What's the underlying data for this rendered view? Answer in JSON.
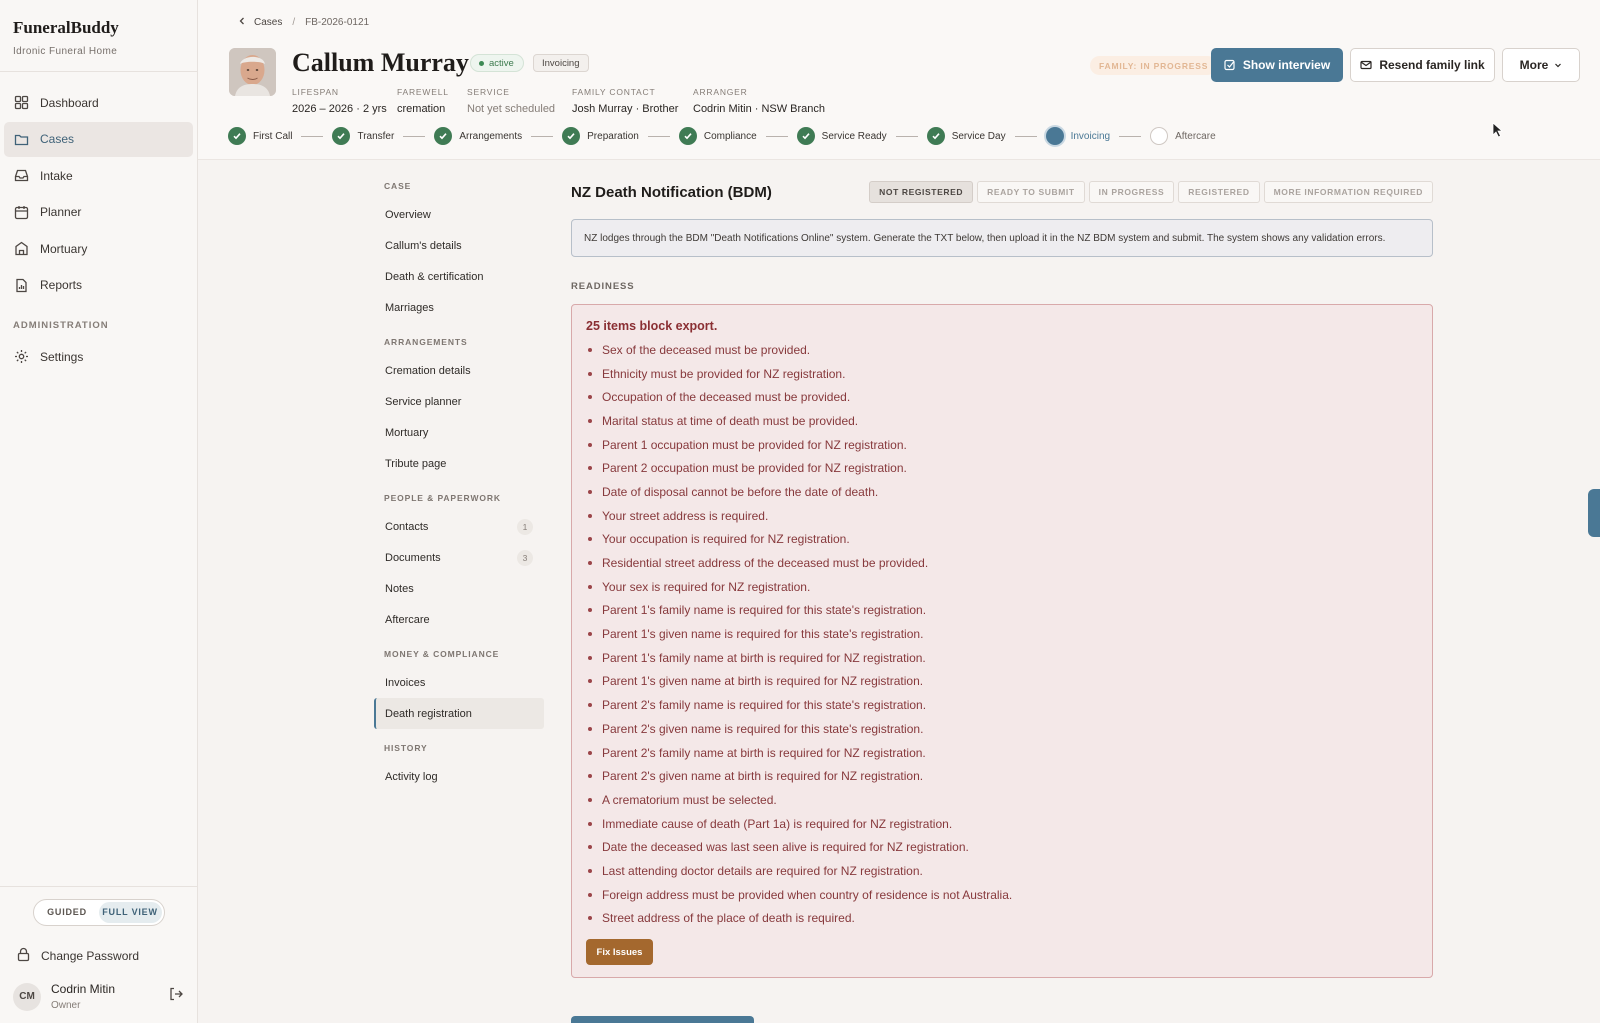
{
  "brand": {
    "name": "FuneralBuddy",
    "org": "Idronic Funeral Home"
  },
  "nav": {
    "items": [
      {
        "label": "Dashboard",
        "icon": "grid-icon"
      },
      {
        "label": "Cases",
        "icon": "folder-icon",
        "active": true
      },
      {
        "label": "Intake",
        "icon": "inbox-icon"
      },
      {
        "label": "Planner",
        "icon": "calendar-icon"
      },
      {
        "label": "Mortuary",
        "icon": "building-icon"
      },
      {
        "label": "Reports",
        "icon": "report-icon"
      }
    ],
    "admin_section": "ADMINISTRATION",
    "settings_label": "Settings"
  },
  "view_toggle": {
    "guided": "GUIDED",
    "full": "FULL VIEW",
    "selected": "FULL VIEW"
  },
  "account": {
    "change_password": "Change Password",
    "initials": "CM",
    "name": "Codrin Mitin",
    "role": "Owner"
  },
  "breadcrumb": {
    "parent": "Cases",
    "current": "FB-2026-0121"
  },
  "case": {
    "name": "Callum Murray",
    "status": "active",
    "stage": "Invoicing",
    "family_status": "FAMILY: IN PROGRESS",
    "meta": [
      {
        "key": "LIFESPAN",
        "value": "2026 – 2026 · 2 yrs"
      },
      {
        "key": "FAREWELL",
        "value": "cremation"
      },
      {
        "key": "SERVICE",
        "value": "Not yet scheduled",
        "muted": true
      },
      {
        "key": "FAMILY CONTACT",
        "value": "Josh Murray · Brother"
      },
      {
        "key": "ARRANGER",
        "value": "Codrin Mitin · NSW Branch"
      }
    ]
  },
  "actions": {
    "show_interview": "Show interview",
    "resend_link": "Resend family link",
    "more": "More"
  },
  "stepper": [
    {
      "label": "First Call",
      "state": "done"
    },
    {
      "label": "Transfer",
      "state": "done"
    },
    {
      "label": "Arrangements",
      "state": "done"
    },
    {
      "label": "Preparation",
      "state": "done"
    },
    {
      "label": "Compliance",
      "state": "done"
    },
    {
      "label": "Service Ready",
      "state": "done"
    },
    {
      "label": "Service Day",
      "state": "done"
    },
    {
      "label": "Invoicing",
      "state": "current"
    },
    {
      "label": "Aftercare",
      "state": "todo"
    }
  ],
  "case_nav": [
    {
      "section": "CASE",
      "items": [
        {
          "label": "Overview"
        },
        {
          "label": "Callum's details"
        },
        {
          "label": "Death & certification"
        },
        {
          "label": "Marriages"
        }
      ]
    },
    {
      "section": "ARRANGEMENTS",
      "items": [
        {
          "label": "Cremation details"
        },
        {
          "label": "Service planner"
        },
        {
          "label": "Mortuary"
        },
        {
          "label": "Tribute page"
        }
      ]
    },
    {
      "section": "PEOPLE & PAPERWORK",
      "items": [
        {
          "label": "Contacts",
          "count": "1"
        },
        {
          "label": "Documents",
          "count": "3"
        },
        {
          "label": "Notes"
        },
        {
          "label": "Aftercare"
        }
      ]
    },
    {
      "section": "MONEY & COMPLIANCE",
      "items": [
        {
          "label": "Invoices"
        },
        {
          "label": "Death registration",
          "active": true
        }
      ]
    },
    {
      "section": "HISTORY",
      "items": [
        {
          "label": "Activity log"
        }
      ]
    }
  ],
  "registration": {
    "title": "NZ Death Notification (BDM)",
    "statuses": [
      "NOT REGISTERED",
      "READY TO SUBMIT",
      "IN PROGRESS",
      "REGISTERED",
      "MORE INFORMATION REQUIRED"
    ],
    "current_status": "NOT REGISTERED",
    "info": "NZ lodges through the BDM \"Death Notifications Online\" system. Generate the TXT below, then upload it in the NZ BDM system and submit. The system shows any validation errors.",
    "readiness_label": "READINESS",
    "blocker_title": "25 items block export.",
    "blockers": [
      "Sex of the deceased must be provided.",
      "Ethnicity must be provided for NZ registration.",
      "Occupation of the deceased must be provided.",
      "Marital status at time of death must be provided.",
      "Parent 1 occupation must be provided for NZ registration.",
      "Parent 2 occupation must be provided for NZ registration.",
      "Date of disposal cannot be before the date of death.",
      "Your street address is required.",
      "Your occupation is required for NZ registration.",
      "Residential street address of the deceased must be provided.",
      "Your sex is required for NZ registration.",
      "Parent 1's family name is required for this state's registration.",
      "Parent 1's given name is required for this state's registration.",
      "Parent 1's family name at birth is required for NZ registration.",
      "Parent 1's given name at birth is required for NZ registration.",
      "Parent 2's family name is required for this state's registration.",
      "Parent 2's given name is required for this state's registration.",
      "Parent 2's family name at birth is required for NZ registration.",
      "Parent 2's given name at birth is required for NZ registration.",
      "A crematorium must be selected.",
      "Immediate cause of death (Part 1a) is required for NZ registration.",
      "Date the deceased was last seen alive is required for NZ registration.",
      "Last attending doctor details are required for NZ registration.",
      "Foreign address must be provided when country of residence is not Australia.",
      "Street address of the place of death is required."
    ],
    "fix_label": "Fix Issues"
  },
  "colors": {
    "accent": "#4a7895",
    "success": "#3f7b54",
    "danger_text": "#87393c",
    "warning_button": "#a4682e"
  }
}
